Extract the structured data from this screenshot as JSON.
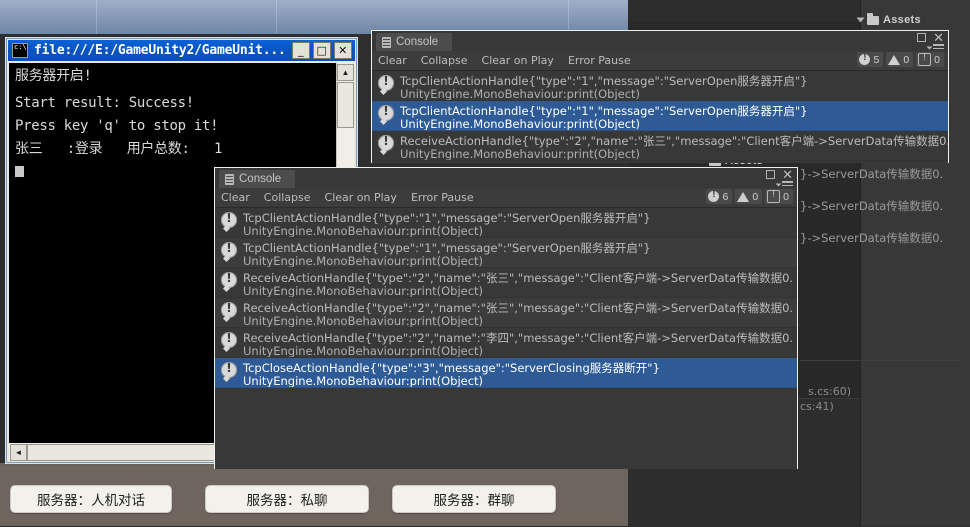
{
  "desktop": {
    "assets_label_top": "Assets",
    "assets_label_mid": "Assets"
  },
  "cmd_window": {
    "title": "file:///E:/GameUnity2/GameUnit...",
    "icon": "cmd-prompt-icon",
    "minimize_label": "_",
    "maximize_label": "□",
    "close_label": "✕",
    "body_lines": [
      "服务器开启!",
      "",
      "Start result: Success!",
      "Press key 'q' to stop it!",
      "张三   :登录   用户总数:   1"
    ],
    "scroll_up_label": "▲",
    "scroll_left_label": "◄"
  },
  "console_back": {
    "tab_label": "Console",
    "toolbar": [
      "Clear",
      "Collapse",
      "Clear on Play",
      "Error Pause"
    ],
    "counters": {
      "errors": "5",
      "warnings": "0",
      "infos": "0"
    },
    "maximize_label": "▫",
    "close_label": "✕",
    "rows": [
      {
        "line1": "TcpClientActionHandle{\"type\":\"1\",\"message\":\"ServerOpen服务器开启\"}",
        "line2": "UnityEngine.MonoBehaviour:print(Object)",
        "selected": false
      },
      {
        "line1": "TcpClientActionHandle{\"type\":\"1\",\"message\":\"ServerOpen服务器开启\"}",
        "line2": "UnityEngine.MonoBehaviour:print(Object)",
        "selected": true
      },
      {
        "line1": "ReceiveActionHandle{\"type\":\"2\",\"name\":\"张三\",\"message\":\"Client客户端->ServerData传输数据0.",
        "line2": "UnityEngine.MonoBehaviour:print(Object)",
        "selected": false
      }
    ]
  },
  "console_front": {
    "tab_label": "Console",
    "toolbar": [
      "Clear",
      "Collapse",
      "Clear on Play",
      "Error Pause"
    ],
    "counters": {
      "errors": "6",
      "warnings": "0",
      "infos": "0"
    },
    "maximize_label": "▫",
    "close_label": "✕",
    "rows": [
      {
        "line1": "TcpClientActionHandle{\"type\":\"1\",\"message\":\"ServerOpen服务器开启\"}",
        "line2": "UnityEngine.MonoBehaviour:print(Object)",
        "selected": false
      },
      {
        "line1": "TcpClientActionHandle{\"type\":\"1\",\"message\":\"ServerOpen服务器开启\"}",
        "line2": "UnityEngine.MonoBehaviour:print(Object)",
        "selected": false
      },
      {
        "line1": "ReceiveActionHandle{\"type\":\"2\",\"name\":\"张三\",\"message\":\"Client客户端->ServerData传输数据0.",
        "line2": "UnityEngine.MonoBehaviour:print(Object)",
        "selected": false
      },
      {
        "line1": "ReceiveActionHandle{\"type\":\"2\",\"name\":\"张三\",\"message\":\"Client客户端->ServerData传输数据0.",
        "line2": "UnityEngine.MonoBehaviour:print(Object)",
        "selected": false
      },
      {
        "line1": "ReceiveActionHandle{\"type\":\"2\",\"name\":\"李四\",\"message\":\"Client客户端->ServerData传输数据0.",
        "line2": "UnityEngine.MonoBehaviour:print(Object)",
        "selected": false
      },
      {
        "line1": "TcpCloseActionHandle{\"type\":\"3\",\"message\":\"ServerClosing服务器断开\"}",
        "line2": "UnityEngine.MonoBehaviour:print(Object)",
        "selected": true
      }
    ]
  },
  "right_fragments": [
    "}->ServerData传输数据0.",
    "}->ServerData传输数据0.",
    "}->ServerData传输数据0."
  ],
  "stack_fragments": [
    "s.cs:60)",
    "cs:41)"
  ],
  "game_buttons": [
    {
      "label": "服务器：人机对话"
    },
    {
      "label": "服务器：私聊"
    },
    {
      "label": "服务器：群聊"
    }
  ]
}
